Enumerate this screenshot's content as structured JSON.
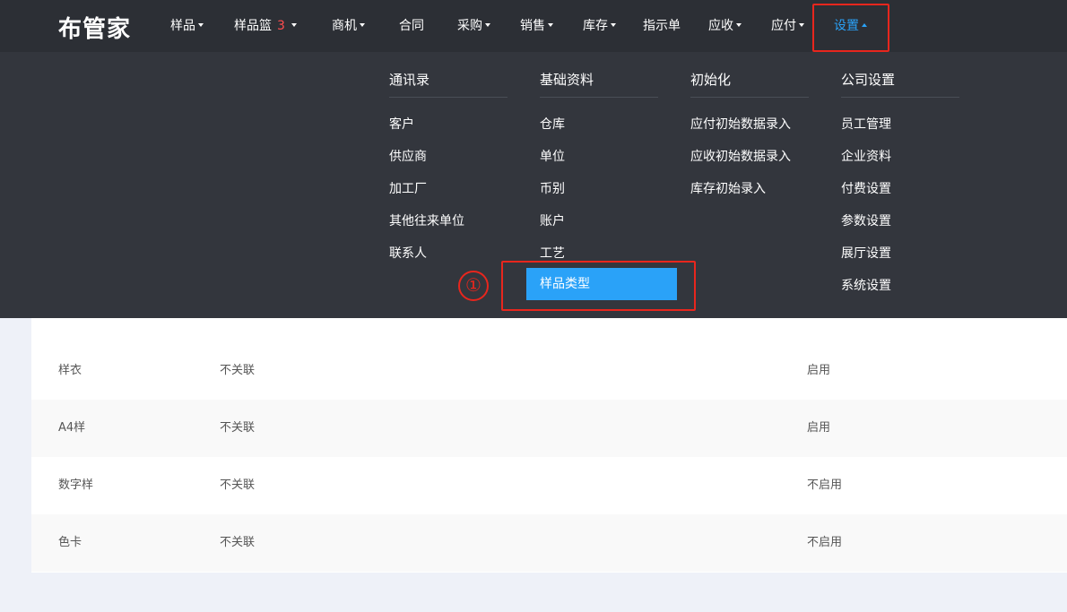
{
  "logo": "布管家",
  "nav": {
    "samples": "样品",
    "basket": "样品篮",
    "basket_count": "3",
    "opportunity": "商机",
    "contract": "合同",
    "purchase": "采购",
    "sales": "销售",
    "inventory": "库存",
    "instruction": "指示单",
    "receivable": "应收",
    "payable": "应付",
    "settings": "设置"
  },
  "menu": {
    "contacts": {
      "title": "通讯录",
      "items": [
        "客户",
        "供应商",
        "加工厂",
        "其他往来单位",
        "联系人"
      ]
    },
    "basic": {
      "title": "基础资料",
      "items": [
        "仓库",
        "单位",
        "币别",
        "账户",
        "工艺",
        "样品类型"
      ]
    },
    "init": {
      "title": "初始化",
      "items": [
        "应付初始数据录入",
        "应收初始数据录入",
        "库存初始录入"
      ]
    },
    "company": {
      "title": "公司设置",
      "items": [
        "员工管理",
        "企业资料",
        "付费设置",
        "参数设置",
        "展厅设置",
        "系统设置"
      ]
    }
  },
  "step_marker": "①",
  "table": {
    "rows": [
      {
        "name": "样衣",
        "link": "不关联",
        "status": "启用"
      },
      {
        "name": "A4样",
        "link": "不关联",
        "status": "启用"
      },
      {
        "name": "数字样",
        "link": "不关联",
        "status": "不启用"
      },
      {
        "name": "色卡",
        "link": "不关联",
        "status": "不启用"
      }
    ]
  },
  "colors": {
    "topbar": "#2c2f35",
    "menu_bg": "#33363d",
    "accent": "#2aa2f8",
    "annotation": "#e8261d"
  }
}
